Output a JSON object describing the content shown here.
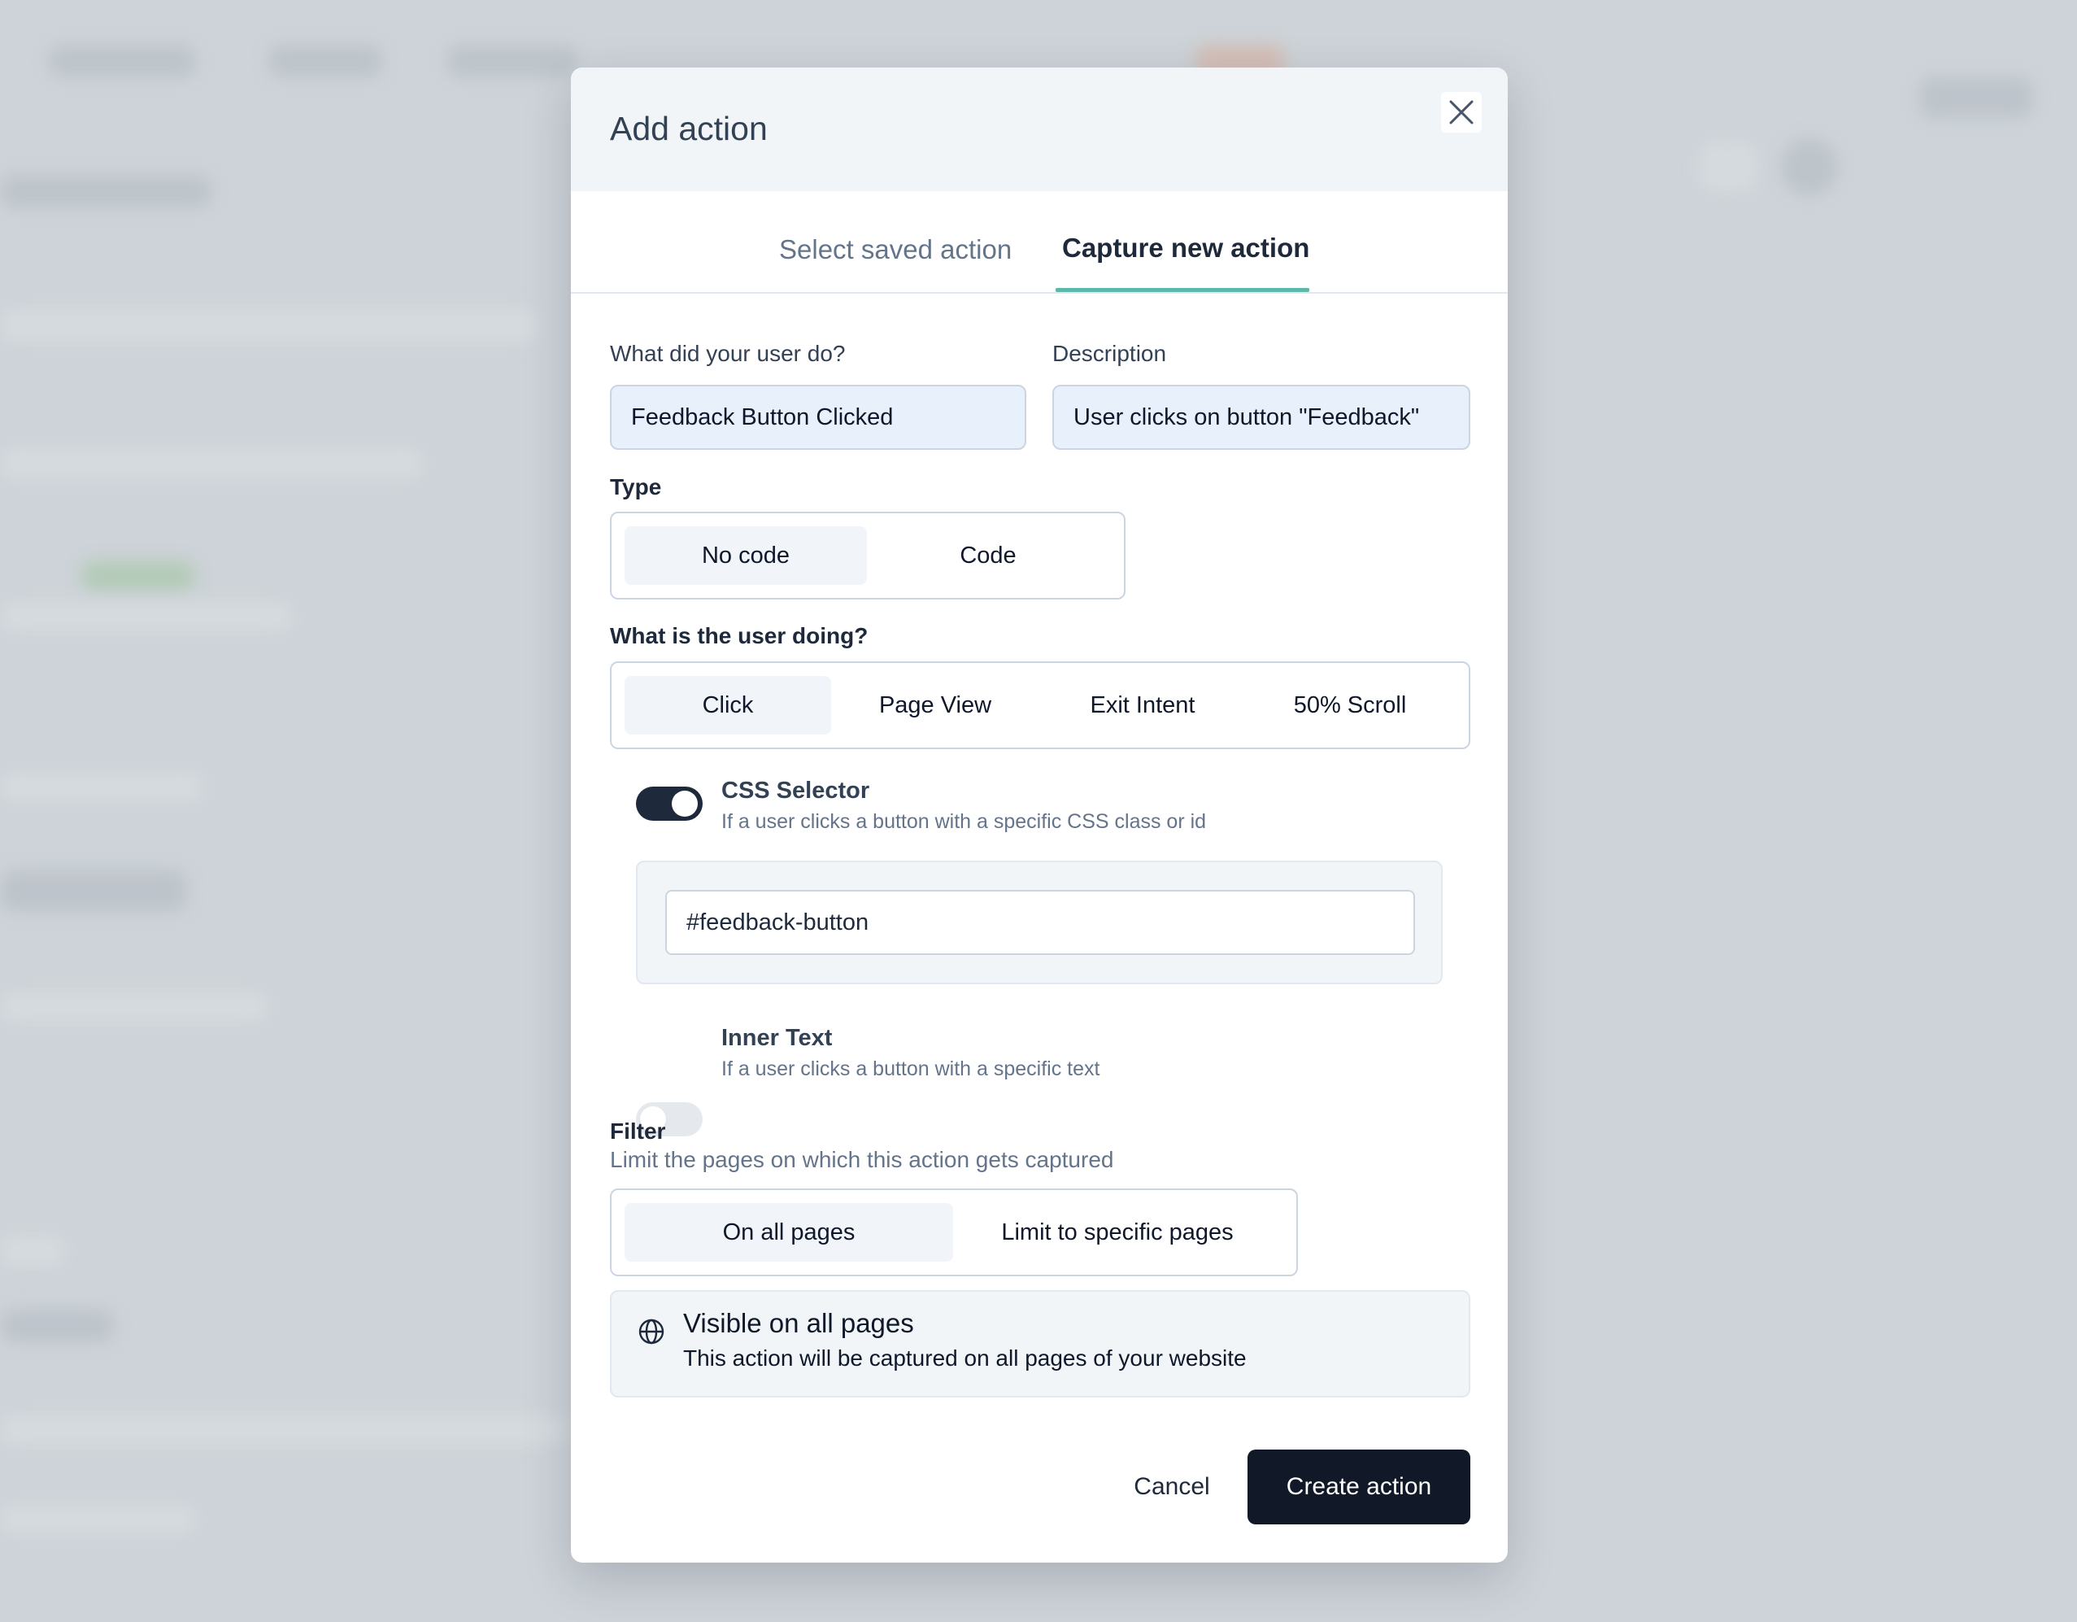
{
  "modal": {
    "title": "Add action",
    "close_icon": "close-icon"
  },
  "tabs": [
    {
      "label": "Select saved action",
      "active": false
    },
    {
      "label": "Capture new action",
      "active": true
    }
  ],
  "form": {
    "action_name_label": "What did your user do?",
    "action_name_value": "Feedback Button Clicked",
    "description_label": "Description",
    "description_value": "User clicks on button \"Feedback\"",
    "type_label": "Type",
    "type_options": [
      {
        "label": "No code",
        "active": true
      },
      {
        "label": "Code",
        "active": false
      }
    ],
    "user_doing_label": "What is the user doing?",
    "user_doing_options": [
      {
        "label": "Click",
        "active": true
      },
      {
        "label": "Page View",
        "active": false
      },
      {
        "label": "Exit Intent",
        "active": false
      },
      {
        "label": "50% Scroll",
        "active": false
      }
    ],
    "css_selector": {
      "title": "CSS Selector",
      "description": "If a user clicks a button with a specific CSS class or id",
      "enabled": true,
      "value": "#feedback-button"
    },
    "inner_text": {
      "title": "Inner Text",
      "description": "If a user clicks a button with a specific text",
      "enabled": false
    },
    "filter": {
      "title": "Filter",
      "subtitle": "Limit the pages on which this action gets captured",
      "options": [
        {
          "label": "On all pages",
          "active": true
        },
        {
          "label": "Limit to specific pages",
          "active": false
        }
      ],
      "info_icon": "globe-icon",
      "info_title": "Visible on all pages",
      "info_description": "This action will be captured on all pages of your website"
    }
  },
  "footer": {
    "cancel_label": "Cancel",
    "create_label": "Create action"
  },
  "colors": {
    "accent": "#5eb8a9",
    "primary_button": "#111827",
    "toggle_on": "#1e293b"
  }
}
